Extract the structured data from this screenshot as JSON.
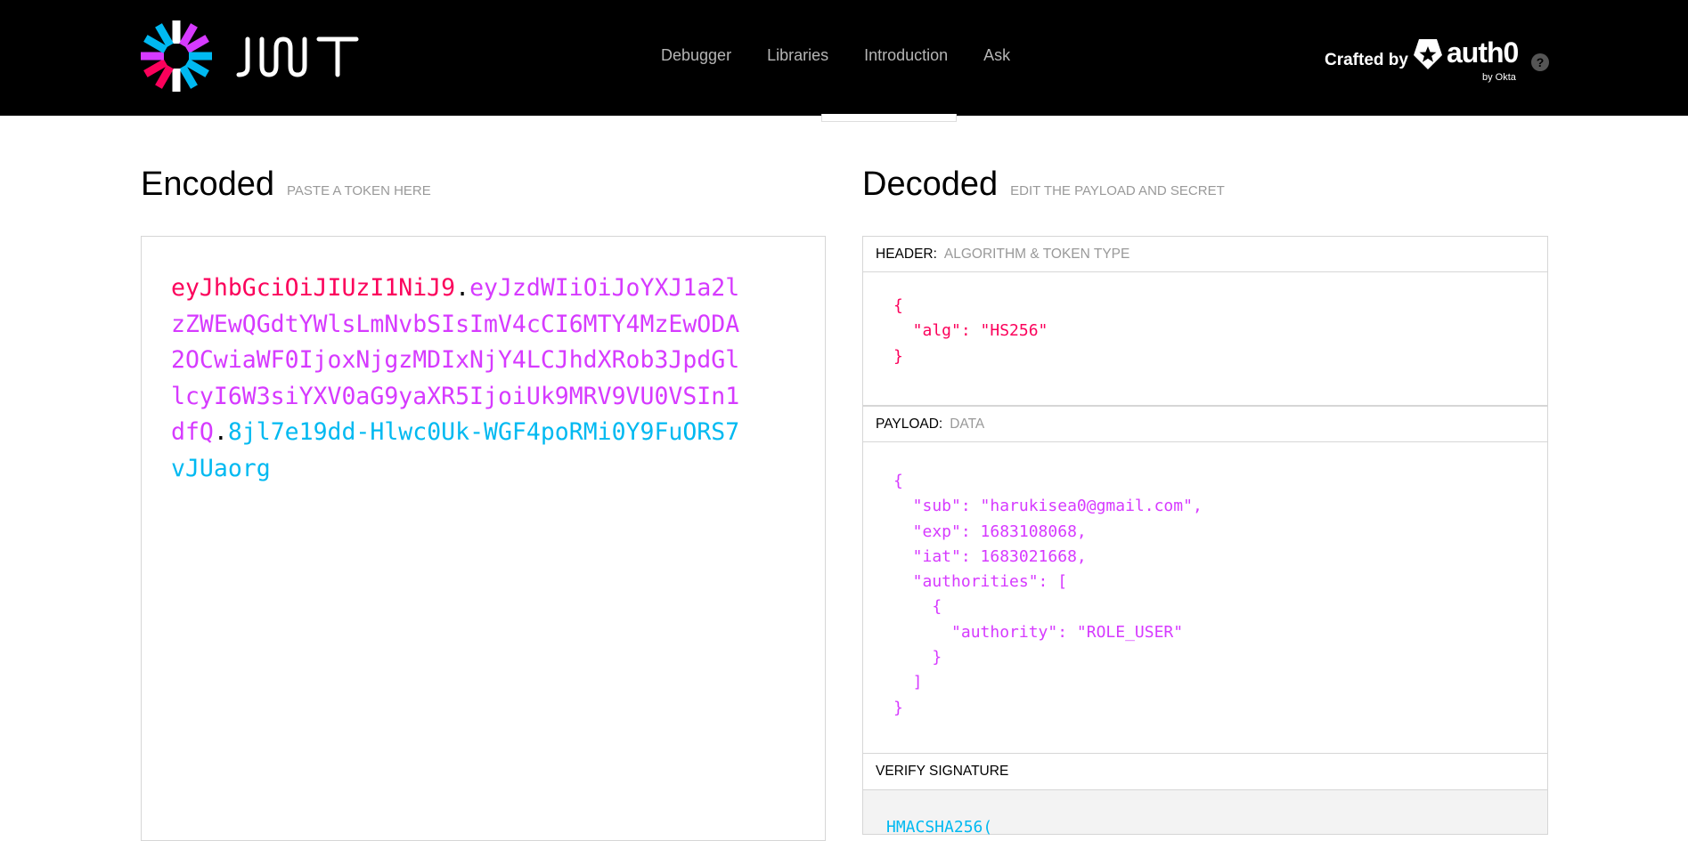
{
  "header": {
    "logo_icon": "jwt-flower-icon",
    "wordmark": "JWT",
    "nav": [
      {
        "label": "Debugger"
      },
      {
        "label": "Libraries"
      },
      {
        "label": "Introduction"
      },
      {
        "label": "Ask"
      }
    ],
    "crafted_by": "Crafted by",
    "brand": "auth0",
    "brand_sub": "by Okta",
    "help_icon": "?"
  },
  "encoded": {
    "title": "Encoded",
    "subtitle": "PASTE A TOKEN HERE",
    "token_header": "eyJhbGciOiJIUzI1NiJ9",
    "token_payload": "eyJzdWIiOiJoYXJ1a2lzZWEwQGdtYWlsLmNvbSIsImV4cCI6MTY4MzEwODA2OCwiaWF0IjoxNjgzMDIxNjY4LCJhdXRob3JpdGllcyI6W3siYXV0aG9yaXR5IjoiUk9MRV9VU0VSIn1dfQ",
    "token_signature": "8jl7e19dd-Hlwc0Uk-WGF4poRMi0Y9FuORS7vJUaorg",
    "dot": "."
  },
  "decoded": {
    "title": "Decoded",
    "subtitle": "EDIT THE PAYLOAD AND SECRET",
    "header_label": "HEADER:",
    "header_desc": "ALGORITHM & TOKEN TYPE",
    "header_json": "{\n  \"alg\": \"HS256\"\n}",
    "payload_label": "PAYLOAD:",
    "payload_desc": "DATA",
    "payload_json": "{\n  \"sub\": \"harukisea0@gmail.com\",\n  \"exp\": 1683108068,\n  \"iat\": 1683021668,\n  \"authorities\": [\n    {\n      \"authority\": \"ROLE_USER\"\n    }\n  ]\n}",
    "signature_label": "VERIFY SIGNATURE",
    "signature_code": "HMACSHA256("
  },
  "colors": {
    "header": "#fb015b",
    "payload": "#d63aff",
    "signature": "#00b9f1"
  }
}
